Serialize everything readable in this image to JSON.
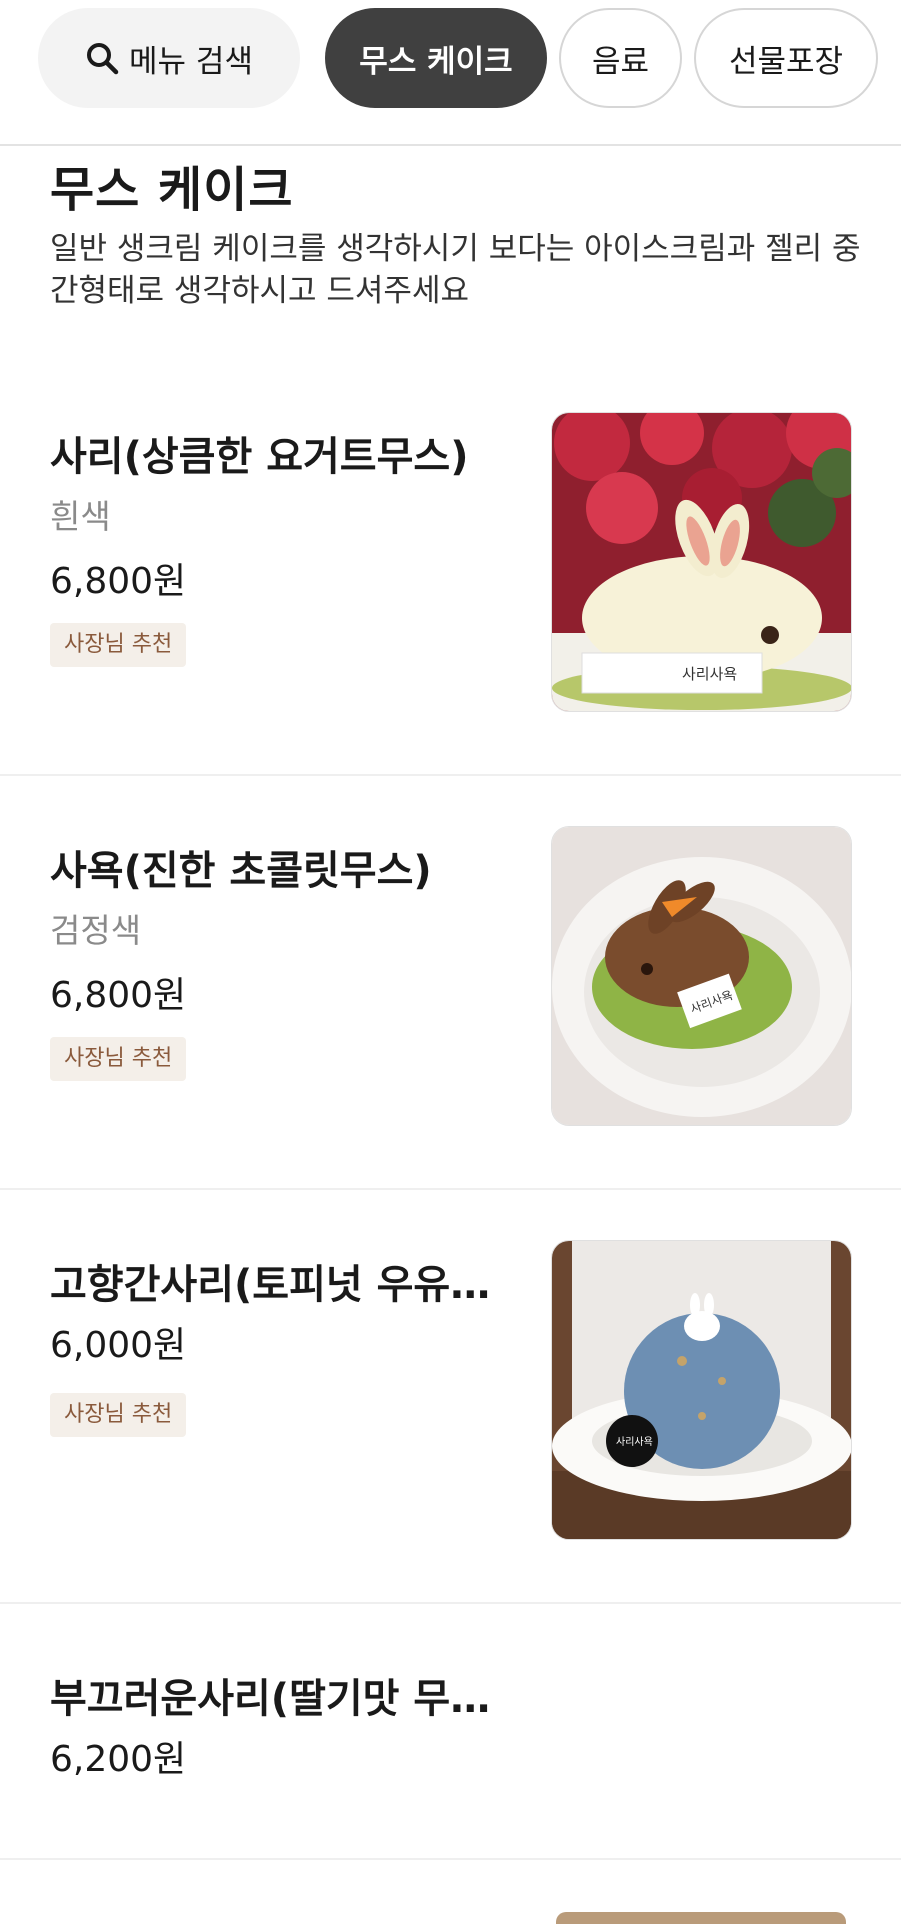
{
  "nav": {
    "search_label": "메뉴 검색",
    "categories": [
      "무스 케이크",
      "음료",
      "선물포장"
    ]
  },
  "section": {
    "title": "무스 케이크",
    "description": "일반 생크림 케이크를 생각하시기 보다는 아이스크림과 젤리 중간형태로 생각하시고 드셔주세요"
  },
  "items": [
    {
      "name": "사리(상큼한 요거트무스)",
      "color": "흰색",
      "price": "6,800원",
      "badge": "사장님 추천",
      "photo_label": "사리사욕"
    },
    {
      "name": "사욕(진한 초콜릿무스)",
      "color": "검정색",
      "price": "6,800원",
      "badge": "사장님 추천",
      "photo_label": "사리사욕"
    },
    {
      "name": "고향간사리(토피넛 우유무스)",
      "price": "6,000원",
      "badge": "사장님 추천",
      "photo_label": "사리사욕"
    },
    {
      "name": "부끄러운사리(딸기맛 무스)",
      "price": "6,200원"
    }
  ],
  "colors": {
    "accent_chip": "#404040",
    "badge_bg": "#f4efe9",
    "badge_text": "#8a5a3c"
  }
}
